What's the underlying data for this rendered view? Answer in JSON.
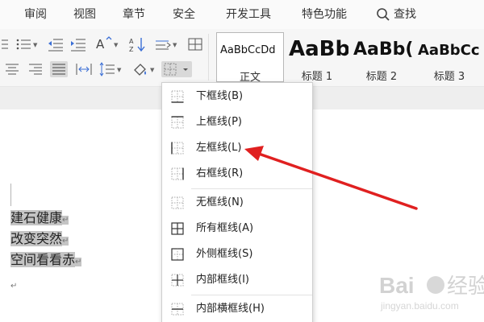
{
  "menu": {
    "items": [
      "审阅",
      "视图",
      "章节",
      "安全",
      "开发工具",
      "特色功能"
    ],
    "search_label": "查找"
  },
  "styles": [
    {
      "sample": "AaBbCcDd",
      "label": "正文"
    },
    {
      "sample": "AaBb",
      "label": "标题 1"
    },
    {
      "sample": "AaBb(",
      "label": "标题 2"
    },
    {
      "sample": "AaBbCc",
      "label": "标题 3"
    }
  ],
  "document": {
    "lines": [
      "建石健康",
      "改变突然",
      "空间看看赤"
    ],
    "paragraph_mark": "↵"
  },
  "border_menu": {
    "items": [
      {
        "label": "下框线(B)",
        "icon": "bottom-border-icon"
      },
      {
        "label": "上框线(P)",
        "icon": "top-border-icon"
      },
      {
        "label": "左框线(L)",
        "icon": "left-border-icon"
      },
      {
        "label": "右框线(R)",
        "icon": "right-border-icon"
      },
      {
        "label": "无框线(N)",
        "icon": "no-border-icon"
      },
      {
        "label": "所有框线(A)",
        "icon": "all-borders-icon"
      },
      {
        "label": "外侧框线(S)",
        "icon": "outside-borders-icon"
      },
      {
        "label": "内部框线(I)",
        "icon": "inside-borders-icon"
      },
      {
        "label": "内部横框线(H)",
        "icon": "inside-horizontal-border-icon"
      }
    ]
  },
  "colors": {
    "annotation_arrow": "#e02020",
    "selection_highlight": "#c4c4c4"
  },
  "watermark": {
    "brand": "Baidu",
    "subtitle": "jingyan.baidu.com"
  }
}
